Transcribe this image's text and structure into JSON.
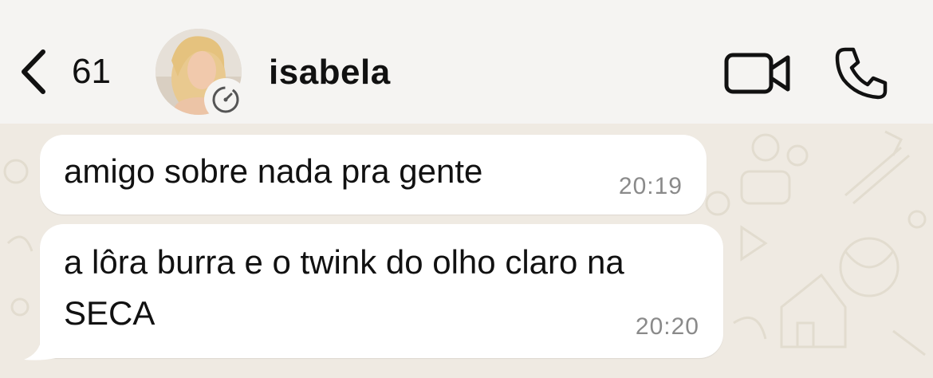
{
  "header": {
    "back_count": "61",
    "contact_name": "isabela",
    "icons": {
      "back": "chevron-left-icon",
      "avatar": "contact-avatar",
      "timer": "disappearing-timer-icon",
      "video": "video-camera-icon",
      "phone": "phone-icon"
    }
  },
  "messages": [
    {
      "text": "amigo sobre nada pra gente",
      "time": "20:19"
    },
    {
      "text": "a lôra burra e o twink do olho claro na SECA",
      "time": "20:20"
    }
  ],
  "colors": {
    "header_bg": "#f5f4f2",
    "chat_bg": "#efeae2",
    "bubble_bg": "#ffffff",
    "time_text": "#8a8a8a"
  }
}
